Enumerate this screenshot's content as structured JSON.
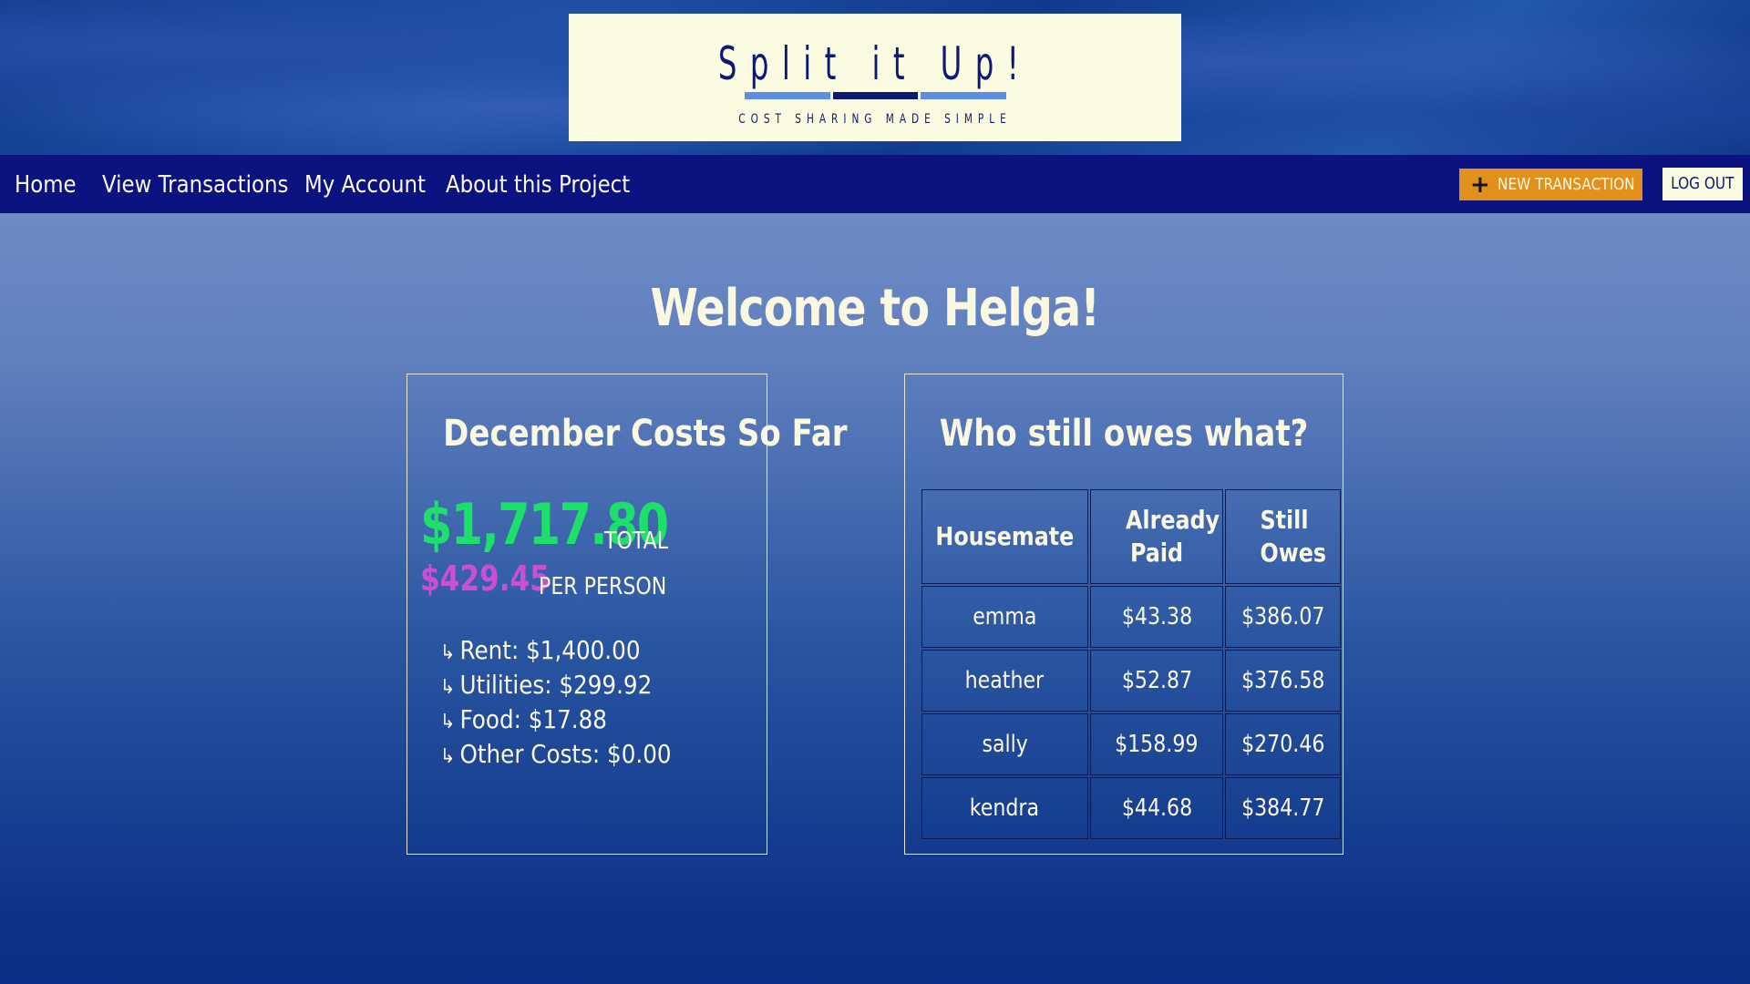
{
  "logo": {
    "title": "Split it Up!",
    "tagline": "COST SHARING MADE SIMPLE"
  },
  "nav": {
    "links": [
      "Home",
      "View Transactions",
      "My Account",
      "About this Project"
    ],
    "new_transaction_label": "NEW TRANSACTION",
    "logout_label": "LOG OUT"
  },
  "page": {
    "welcome": "Welcome to Helga!"
  },
  "costs": {
    "title": "December Costs So Far",
    "total_amount": "$1,717.80",
    "total_label": "TOTAL",
    "per_person_amount": "$429.45",
    "per_person_label": "PER PERSON",
    "breakdown": [
      "Rent: $1,400.00",
      "Utilities: $299.92",
      "Food: $17.88",
      "Other Costs: $0.00"
    ],
    "arrow_glyph": "↳"
  },
  "owes": {
    "title": "Who still owes what?",
    "headers": [
      "Housemate",
      "Already Paid",
      "Still Owes"
    ],
    "rows": [
      [
        "emma",
        "$43.38",
        "$386.07"
      ],
      [
        "heather",
        "$52.87",
        "$376.58"
      ],
      [
        "sally",
        "$158.99",
        "$270.46"
      ],
      [
        "kendra",
        "$44.68",
        "$384.77"
      ]
    ]
  },
  "colors": {
    "nav_bg": "#0a1380",
    "accent_orange": "#e1901c",
    "total_green": "#1ce06a",
    "per_person_magenta": "#c94fd6",
    "cream": "#fbf8e2"
  }
}
